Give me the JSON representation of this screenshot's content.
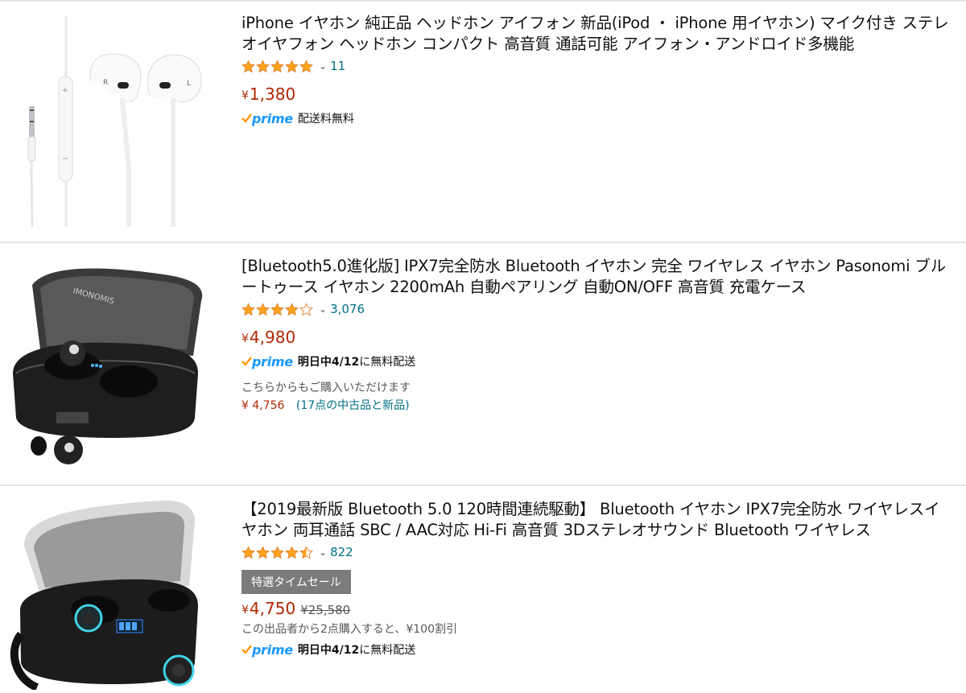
{
  "results": [
    {
      "title": "iPhone イヤホン 純正品 ヘッドホン アイフォン 新品(iPod ・ iPhone 用イヤホン) マイク付き ステレオイヤフォン ヘッドホン コンパクト 高音質 通話可能 アイフォン・アンドロイド多機能",
      "rating": 5,
      "review_count": "11",
      "price_symbol": "¥",
      "price": "1,380",
      "prime_label": "prime",
      "delivery_text": "配送料無料",
      "image": "white-wired-earphones"
    },
    {
      "title": "[Bluetooth5.0進化版] IPX7完全防水 Bluetooth イヤホン 完全 ワイヤレス イヤホン Pasonomi ブルートゥース イヤホン 2200mAh 自動ペアリング 自動ON/OFF 高音質 充電ケース",
      "rating": 4,
      "review_count": "3,076",
      "price_symbol": "¥",
      "price": "4,980",
      "prime_label": "prime",
      "delivery_bold": "明日中4/12",
      "delivery_text": "に無料配送",
      "other_offers_text": "こちらからもご購入いただけます",
      "other_price": "¥ 4,756",
      "other_link": "(17点の中古品と新品)",
      "image": "black-earbuds-case"
    },
    {
      "title": "【2019最新版 Bluetooth 5.0 120時間連続駆動】 Bluetooth イヤホン IPX7完全防水 ワイヤレスイヤホン 両耳通話 SBC / AAC対応 Hi-Fi 高音質 3Dステレオサウンド Bluetooth ワイヤレス",
      "rating": 4.5,
      "review_count": "822",
      "deal_badge": "特選タイムセール",
      "price_symbol": "¥",
      "price": "4,750",
      "list_price": "¥25,580",
      "coupon_text": "この出品者から2点購入すると、¥100割引",
      "prime_label": "prime",
      "delivery_bold": "明日中4/12",
      "delivery_text": "に無料配送",
      "image": "black-earbuds-power-bank-case"
    }
  ],
  "colors": {
    "price": "#b12704",
    "link": "#007185",
    "star": "#ffa41c",
    "prime": "#1a98ff",
    "badge": "#7b7b7b"
  }
}
